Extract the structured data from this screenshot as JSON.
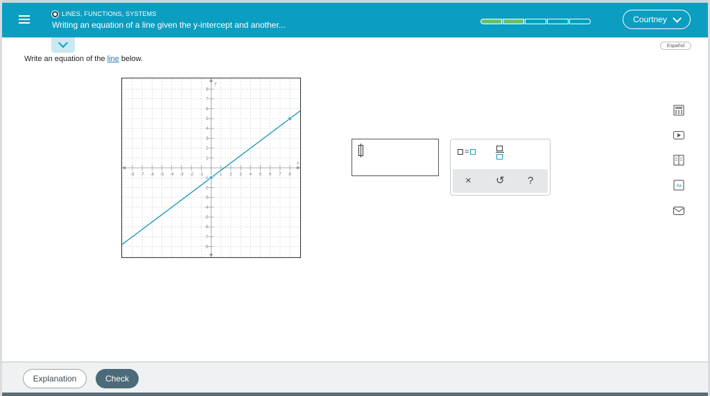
{
  "header": {
    "topic": "LINES, FUNCTIONS, SYSTEMS",
    "lesson_title": "Writing an equation of a line given the y-intercept and another...",
    "progress": {
      "filled": 2,
      "total": 5
    },
    "user_name": "Courtney"
  },
  "language_button": "Español",
  "prompt": {
    "before": "Write an equation of the ",
    "link": "line",
    "after": " below."
  },
  "graph": {
    "x_label": "x",
    "y_label": "y",
    "x_range": [
      -9,
      9
    ],
    "y_range": [
      -9,
      9
    ],
    "x_ticks": [
      "-8",
      "-7",
      "-6",
      "-5",
      "-4",
      "-3",
      "-2",
      "-1",
      "1",
      "2",
      "3",
      "4",
      "5",
      "6",
      "7",
      "8"
    ],
    "y_ticks": [
      "8",
      "7",
      "6",
      "5",
      "4",
      "3",
      "2",
      "1",
      "-1",
      "-2",
      "-3",
      "-4",
      "-5",
      "-6",
      "-7",
      "-8"
    ],
    "line": {
      "slope": 0.75,
      "intercept": -1
    },
    "points": [
      {
        "x": 0,
        "y": -1
      },
      {
        "x": 8,
        "y": 5
      }
    ],
    "line_color": "#1a9cbf"
  },
  "answer": {
    "value": ""
  },
  "palette": {
    "clear_symbol": "×",
    "undo_symbol": "↺",
    "help_symbol": "?"
  },
  "tools": [
    "calculator-icon",
    "video-icon",
    "textbook-icon",
    "glossary-icon",
    "email-icon"
  ],
  "footer": {
    "explanation_label": "Explanation",
    "check_label": "Check"
  },
  "colors": {
    "header": "#0c9ec1",
    "progress_fill": "#67c26c",
    "check_button": "#4b6b7a"
  }
}
